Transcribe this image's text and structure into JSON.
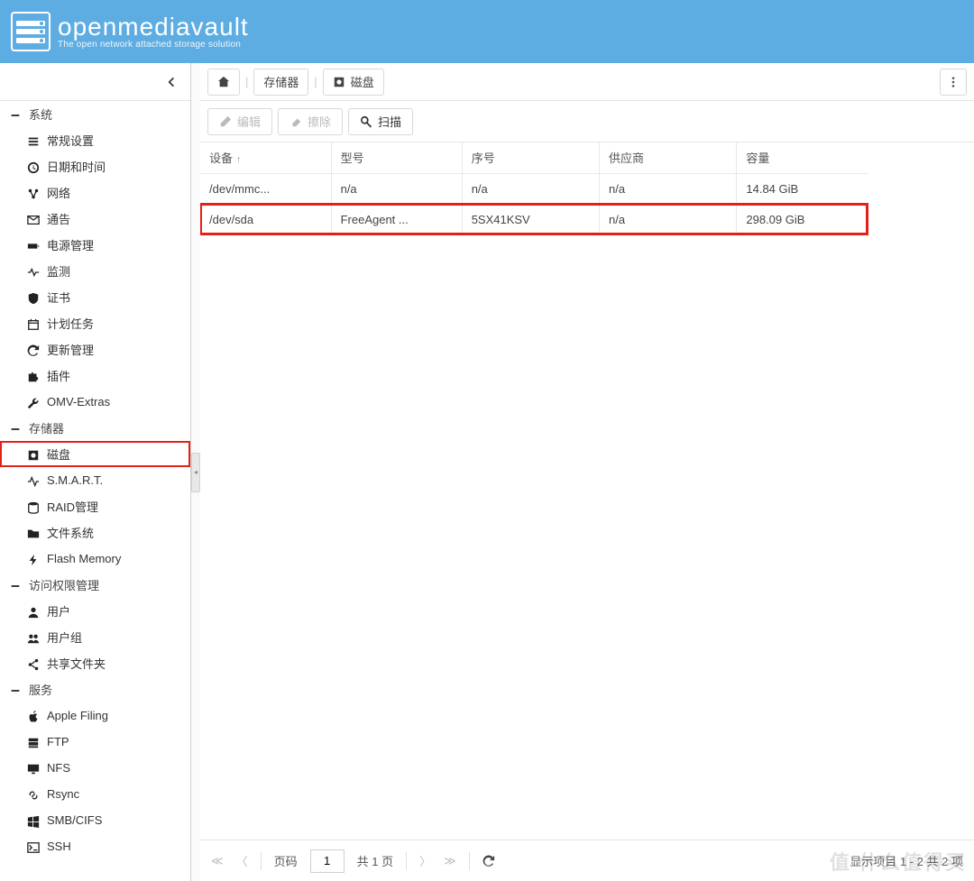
{
  "brand": {
    "title": "openmediavault",
    "subtitle": "The open network attached storage solution"
  },
  "sidebar": {
    "sections": [
      {
        "label": "系统",
        "items": [
          {
            "icon": "sliders",
            "label": "常规设置"
          },
          {
            "icon": "clock",
            "label": "日期和时间"
          },
          {
            "icon": "share",
            "label": "网络"
          },
          {
            "icon": "envelope",
            "label": "通告"
          },
          {
            "icon": "battery",
            "label": "电源管理"
          },
          {
            "icon": "heartbeat",
            "label": "监测"
          },
          {
            "icon": "shield",
            "label": "证书"
          },
          {
            "icon": "calendar",
            "label": "计划任务"
          },
          {
            "icon": "refresh",
            "label": "更新管理"
          },
          {
            "icon": "puzzle",
            "label": "插件"
          },
          {
            "icon": "wrench",
            "label": "OMV-Extras"
          }
        ]
      },
      {
        "label": "存储器",
        "items": [
          {
            "icon": "hdd",
            "label": "磁盘",
            "highlight": true
          },
          {
            "icon": "activity",
            "label": "S.M.A.R.T."
          },
          {
            "icon": "database",
            "label": "RAID管理"
          },
          {
            "icon": "folder",
            "label": "文件系统"
          },
          {
            "icon": "bolt",
            "label": "Flash Memory"
          }
        ]
      },
      {
        "label": "访问权限管理",
        "items": [
          {
            "icon": "user",
            "label": "用户"
          },
          {
            "icon": "users",
            "label": "用户组"
          },
          {
            "icon": "sharealt",
            "label": "共享文件夹"
          }
        ]
      },
      {
        "label": "服务",
        "items": [
          {
            "icon": "apple",
            "label": "Apple Filing"
          },
          {
            "icon": "server",
            "label": "FTP"
          },
          {
            "icon": "desktop",
            "label": "NFS"
          },
          {
            "icon": "link",
            "label": "Rsync"
          },
          {
            "icon": "windows",
            "label": "SMB/CIFS"
          },
          {
            "icon": "terminal",
            "label": "SSH"
          }
        ]
      }
    ]
  },
  "breadcrumb": {
    "items": [
      {
        "icon": "home",
        "label": ""
      },
      {
        "icon": "",
        "label": "存储器"
      },
      {
        "icon": "hdd",
        "label": "磁盘"
      }
    ]
  },
  "toolbar": {
    "edit": "编辑",
    "wipe": "擦除",
    "scan": "扫描"
  },
  "table": {
    "columns": [
      "设备",
      "型号",
      "序号",
      "供应商",
      "容量"
    ],
    "rows": [
      {
        "device": "/dev/mmc...",
        "model": "n/a",
        "serial": "n/a",
        "vendor": "n/a",
        "capacity": "14.84 GiB",
        "highlight": false
      },
      {
        "device": "/dev/sda",
        "model": "FreeAgent ...",
        "serial": "5SX41KSV",
        "vendor": "n/a",
        "capacity": "298.09 GiB",
        "highlight": true
      }
    ]
  },
  "pager": {
    "page_label": "页码",
    "page_value": "1",
    "total_label": "共 1 页",
    "info": "显示项目 1 - 2 共 2 项"
  },
  "watermark": "值 什么值得买"
}
